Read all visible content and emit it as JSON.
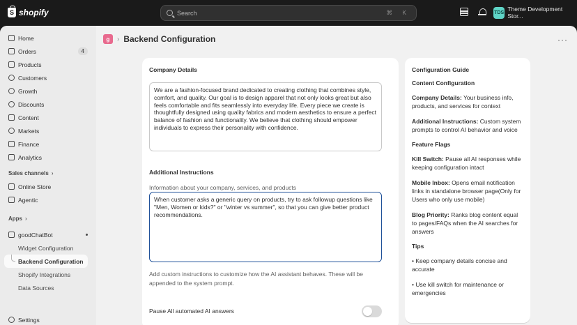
{
  "topbar": {
    "brand": "shopify",
    "search_placeholder": "Search",
    "shortcut": "⌘ K",
    "store_avatar": "TDS",
    "store_name": "Theme Development Stor..."
  },
  "sidebar": {
    "items": [
      {
        "label": "Home"
      },
      {
        "label": "Orders",
        "badge": "4"
      },
      {
        "label": "Products"
      },
      {
        "label": "Customers"
      },
      {
        "label": "Growth"
      },
      {
        "label": "Discounts"
      },
      {
        "label": "Content"
      },
      {
        "label": "Markets"
      },
      {
        "label": "Finance"
      },
      {
        "label": "Analytics"
      }
    ],
    "sales_channels_label": "Sales channels",
    "sales_channels": [
      {
        "label": "Online Store"
      },
      {
        "label": "Agentic"
      }
    ],
    "apps_label": "Apps",
    "app": {
      "label": "goodChatBot"
    },
    "app_sub": [
      {
        "label": "Widget Configuration"
      },
      {
        "label": "Backend Configuration"
      },
      {
        "label": "Shopify Integrations"
      },
      {
        "label": "Data Sources"
      }
    ],
    "settings_label": "Settings"
  },
  "header": {
    "app_badge": "g",
    "separator": "›",
    "title": "Backend Configuration",
    "more": "···"
  },
  "form": {
    "company_label": "Company Details",
    "company_value": "We are a fashion-focused brand dedicated to creating clothing that combines style, comfort, and quality. Our goal is to design apparel that not only looks great but also feels comfortable and fits seamlessly into everyday life. Every piece we create is thoughtfully designed using quality fabrics and modern aesthetics to ensure a perfect balance of fashion and functionality. We believe that clothing should empower individuals to express their personality with confidence.",
    "company_help": "Information about your company, services, and products",
    "instructions_label": "Additional Instructions",
    "instructions_value": "When customer asks a generic query on products, try to ask followup questions like \"Men, Women or kids?\" or \"winter vs summer\", so that you can give better product recommendations.",
    "instructions_help": "Add custom instructions to customize how the AI assistant behaves. These will be appended to the system prompt.",
    "pause_label": "Pause All automated AI answers",
    "pause_enabled": false
  },
  "guide": {
    "title": "Configuration Guide",
    "content_heading": "Content Configuration",
    "content_items": [
      {
        "term": "Company Details:",
        "desc": " Your business info, products, and services for context"
      },
      {
        "term": "Additional Instructions:",
        "desc": " Custom system prompts to control AI behavior and voice"
      }
    ],
    "flags_heading": "Feature Flags",
    "flag_items": [
      {
        "term": "Kill Switch:",
        "desc": " Pause all AI responses while keeping configuration intact"
      },
      {
        "term": "Mobile Inbox:",
        "desc": " Opens email notification links in standalone browser page(Only for Users who only use mobile)"
      },
      {
        "term": "Blog Priority:",
        "desc": " Ranks blog content equal to pages/FAQs when the AI searches for answers"
      }
    ],
    "tips_heading": "Tips",
    "tips": [
      "• Keep company details concise and accurate",
      "• Use kill switch for maintenance or emergencies"
    ]
  }
}
